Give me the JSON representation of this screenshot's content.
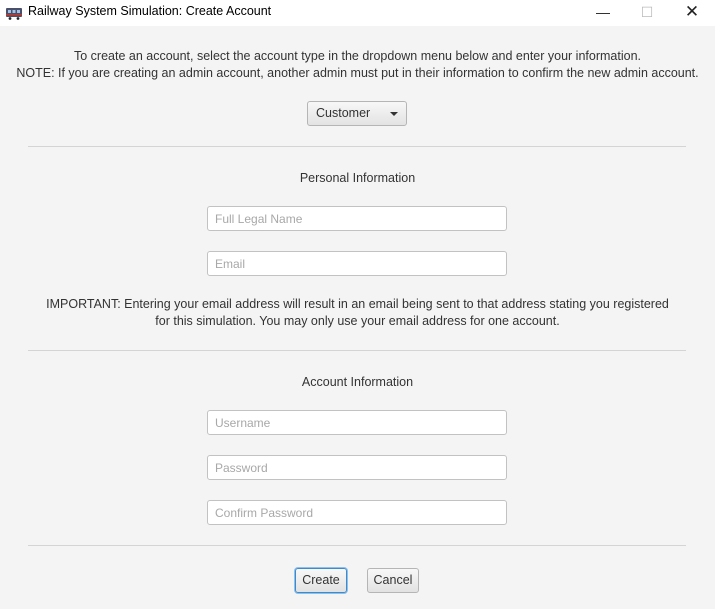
{
  "window": {
    "title": "Railway System Simulation: Create Account",
    "controls": {
      "minimize": "—",
      "maximize": "☐",
      "close": "✕"
    }
  },
  "intro": {
    "line1": "To create an account, select the account type in the dropdown menu below and enter your information.",
    "line2": "NOTE: If you are creating an admin account, another admin must put in their information to confirm the new admin account."
  },
  "account_type": {
    "selected": "Customer"
  },
  "personal": {
    "heading": "Personal Information",
    "full_name_placeholder": "Full Legal Name",
    "email_placeholder": "Email",
    "notice_line1": "IMPORTANT: Entering your email address will result in an email being sent to that address stating you registered",
    "notice_line2": "for this simulation. You may only use your email address for one account."
  },
  "account": {
    "heading": "Account Information",
    "username_placeholder": "Username",
    "password_placeholder": "Password",
    "confirm_password_placeholder": "Confirm Password"
  },
  "actions": {
    "create_label": "Create",
    "cancel_label": "Cancel"
  },
  "colors": {
    "background": "#f4f4f4",
    "focus_border": "#3d8bcf",
    "separator": "#d4d4d4"
  }
}
